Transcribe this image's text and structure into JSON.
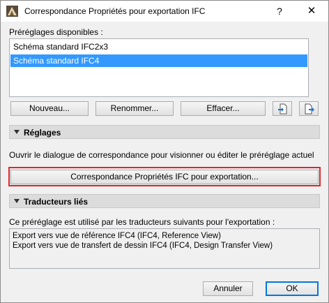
{
  "window": {
    "title": "Correspondance Propriétés pour exportation IFC",
    "help_label": "?",
    "close_label": "✕"
  },
  "presets": {
    "label": "Préréglages disponibles :",
    "items": [
      {
        "label": "Schéma standard IFC2x3",
        "selected": false
      },
      {
        "label": "Schéma standard IFC4",
        "selected": true
      }
    ],
    "buttons": {
      "new": "Nouveau...",
      "rename": "Renommer...",
      "delete": "Effacer..."
    },
    "icons": [
      "import-icon",
      "export-icon"
    ]
  },
  "settings": {
    "title": "Réglages",
    "description": "Ouvrir le dialogue de correspondance pour visionner ou éditer le préréglage actuel",
    "mapping_button": "Correspondance Propriétés IFC pour exportation..."
  },
  "translators": {
    "title": "Traducteurs liés",
    "description": "Ce préréglage est utilisé par les traducteurs suivants pour l'exportation :",
    "lines": [
      "Export vers vue de référence IFC4 (IFC4, Reference View)",
      "Export vers vue de transfert de dessin IFC4 (IFC4, Design Transfer View)"
    ]
  },
  "footer": {
    "cancel": "Annuler",
    "ok": "OK"
  },
  "colors": {
    "selection": "#3399ff",
    "highlight_frame": "#e0262b",
    "primary_border": "#0078d7"
  }
}
